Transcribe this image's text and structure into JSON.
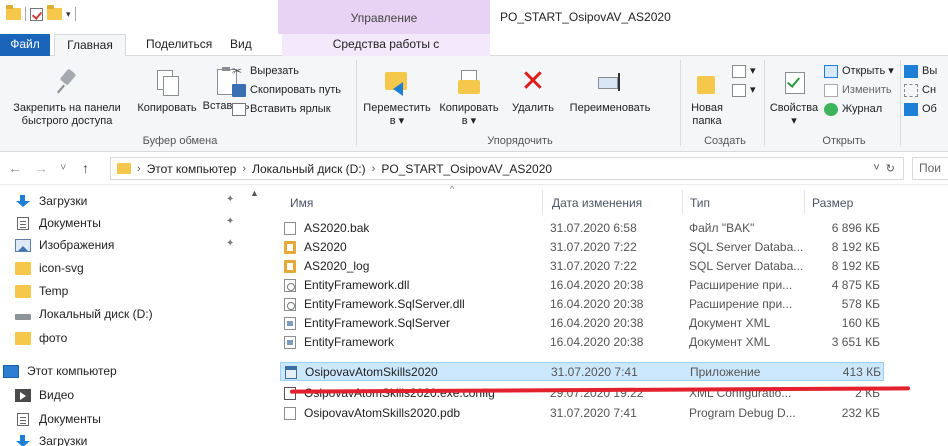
{
  "titlebar": {
    "context_tab": "Управление",
    "window_title": "PO_START_OsipovAV_AS2020"
  },
  "tabs": {
    "file": "Файл",
    "home": "Главная",
    "share": "Поделиться",
    "view": "Вид",
    "app_tools": "Средства работы с приложениями"
  },
  "ribbon": {
    "clipboard": {
      "pin_line1": "Закрепить на панели",
      "pin_line2": "быстрого доступа",
      "copy": "Копировать",
      "paste": "Вставить",
      "cut": "Вырезать",
      "copy_path": "Скопировать путь",
      "paste_shortcut": "Вставить ярлык",
      "label": "Буфер обмена"
    },
    "organize": {
      "move_to": "Переместить",
      "move_to_sub": "в ▾",
      "copy_to": "Копировать",
      "copy_to_sub": "в ▾",
      "delete": "Удалить",
      "rename": "Переименовать",
      "label": "Упорядочить"
    },
    "create": {
      "new_folder_line1": "Новая",
      "new_folder_line2": "папка",
      "label": "Создать"
    },
    "open": {
      "properties": "Свойства",
      "properties_sub": "▾",
      "open": "Открыть ▾",
      "edit": "Изменить",
      "journal": "Журнал",
      "label": "Открыть"
    },
    "select": {
      "item1": "Вы",
      "item2": "Сн",
      "item3": "Об"
    }
  },
  "addressbar": {
    "back": "←",
    "forward": "→",
    "recent": "˅",
    "up": "↑",
    "path": [
      "Этот компьютер",
      "Локальный диск (D:)",
      "PO_START_OsipovAV_AS2020"
    ],
    "separator": "›",
    "dropdown": "˅",
    "refresh": "↻",
    "search_placeholder": "Пои"
  },
  "navpane": {
    "items": [
      {
        "label": "Загрузки",
        "icon": "download-icon",
        "pinned": true
      },
      {
        "label": "Документы",
        "icon": "documents-icon",
        "pinned": true
      },
      {
        "label": "Изображения",
        "icon": "pictures-icon",
        "pinned": true
      },
      {
        "label": "icon-svg",
        "icon": "folder-icon",
        "pinned": false
      },
      {
        "label": "Temp",
        "icon": "folder-icon",
        "pinned": false
      },
      {
        "label": "Локальный диск (D:)",
        "icon": "disk-icon",
        "pinned": false
      },
      {
        "label": "фото",
        "icon": "folder-icon",
        "pinned": false
      },
      {
        "label": "Этот компьютер",
        "icon": "computer-icon",
        "pinned": false
      },
      {
        "label": "Видео",
        "icon": "video-icon",
        "pinned": false
      },
      {
        "label": "Документы",
        "icon": "documents-icon",
        "pinned": false
      },
      {
        "label": "Загрузки",
        "icon": "download-icon",
        "pinned": false
      }
    ],
    "pin_glyph": "📌"
  },
  "filelist": {
    "columns": {
      "name": "Имя",
      "date": "Дата изменения",
      "type": "Тип",
      "size": "Размер"
    },
    "sort_glyph": "^",
    "rows": [
      {
        "name": "AS2020.bak",
        "date": "31.07.2020 6:58",
        "type": "Файл \"BAK\"",
        "size": "6 896 КБ",
        "icon": "generic"
      },
      {
        "name": "AS2020",
        "date": "31.07.2020 7:22",
        "type": "SQL Server Databa...",
        "size": "8 192 КБ",
        "icon": "db"
      },
      {
        "name": "AS2020_log",
        "date": "31.07.2020 7:22",
        "type": "SQL Server Databa...",
        "size": "8 192 КБ",
        "icon": "db"
      },
      {
        "name": "EntityFramework.dll",
        "date": "16.04.2020 20:38",
        "type": "Расширение при...",
        "size": "4 875 КБ",
        "icon": "dll"
      },
      {
        "name": "EntityFramework.SqlServer.dll",
        "date": "16.04.2020 20:38",
        "type": "Расширение при...",
        "size": "578 КБ",
        "icon": "dll"
      },
      {
        "name": "EntityFramework.SqlServer",
        "date": "16.04.2020 20:38",
        "type": "Документ XML",
        "size": "160 КБ",
        "icon": "xml"
      },
      {
        "name": "EntityFramework",
        "date": "16.04.2020 20:38",
        "type": "Документ XML",
        "size": "3 651 КБ",
        "icon": "xml"
      },
      {
        "name": "OsipovavAtomSkills2020",
        "date": "31.07.2020 7:41",
        "type": "Приложение",
        "size": "413 КБ",
        "icon": "exe",
        "selected": true
      },
      {
        "name": "OsipovavAtomSkills2020.exe.config",
        "date": "29.07.2020 19:22",
        "type": "XML Configuratio...",
        "size": "2 КБ",
        "icon": "cfg"
      },
      {
        "name": "OsipovavAtomSkills2020.pdb",
        "date": "31.07.2020 7:41",
        "type": "Program Debug D...",
        "size": "232 КБ",
        "icon": "generic"
      }
    ]
  },
  "colors": {
    "file_tab": "#1a65b9",
    "context_band": "#e8d3f5",
    "selection": "#cce8ff",
    "annotation": "#e3202d"
  }
}
